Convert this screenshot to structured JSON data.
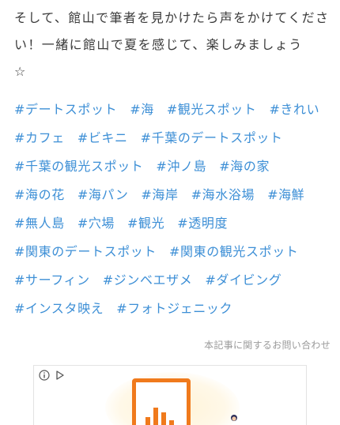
{
  "article": {
    "paragraph": "そして、館山で筆者を見かけたら声をかけてください！一緒に館山で夏を感じて、楽しみましょう",
    "star": "☆"
  },
  "tags": [
    [
      "#デートスポット",
      "#海",
      "#観光スポット",
      "#きれい"
    ],
    [
      "#カフェ",
      "#ビキニ",
      "#千葉のデートスポット"
    ],
    [
      "#千葉の観光スポット",
      "#沖ノ島",
      "#海の家"
    ],
    [
      "#海の花",
      "#海パン",
      "#海岸",
      "#海水浴場",
      "#海鮮"
    ],
    [
      "#無人島",
      "#穴場",
      "#観光",
      "#透明度"
    ],
    [
      "#関東のデートスポット",
      "#関東の観光スポット"
    ],
    [
      "#サーフィン",
      "#ジンベエザメ",
      "#ダイビング"
    ],
    [
      "#インスタ映え",
      "#フォトジェニック"
    ]
  ],
  "contact": {
    "label": "本記事に関するお問い合わせ"
  },
  "ad": {
    "info_icon": "info-icon",
    "choices_icon": "play-triangle-icon",
    "accent_color": "#f07a1c"
  },
  "colors": {
    "tag": "#3d8fd6",
    "text": "#3a3a3a",
    "muted": "#9a9a9a"
  }
}
